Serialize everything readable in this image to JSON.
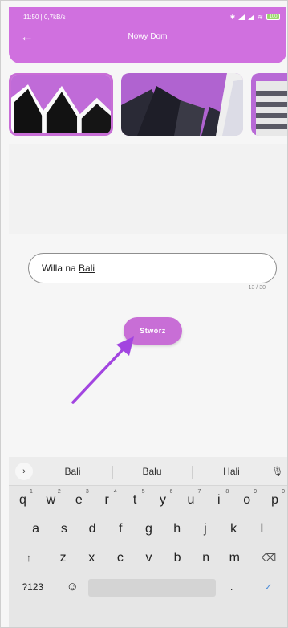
{
  "status_bar": {
    "time": "11:50 | 0,7kB/s",
    "battery": "100"
  },
  "header": {
    "title": "Nowy Dom",
    "back_icon": "arrow-left-icon"
  },
  "colors": {
    "accent": "#c86ed6",
    "header": "#d070df",
    "confirm": "#4a8bd8"
  },
  "name_input": {
    "value_prefix": "Willa na ",
    "value_word": "Bali",
    "counter": "13 / 30"
  },
  "create_button": {
    "label": "Stwórz"
  },
  "keyboard": {
    "suggestions": [
      "Bali",
      "Balu",
      "Hali"
    ],
    "row1": [
      {
        "k": "q",
        "n": "1"
      },
      {
        "k": "w",
        "n": "2"
      },
      {
        "k": "e",
        "n": "3"
      },
      {
        "k": "r",
        "n": "4"
      },
      {
        "k": "t",
        "n": "5"
      },
      {
        "k": "y",
        "n": "6"
      },
      {
        "k": "u",
        "n": "7"
      },
      {
        "k": "i",
        "n": "8"
      },
      {
        "k": "o",
        "n": "9"
      },
      {
        "k": "p",
        "n": "0"
      }
    ],
    "row2": [
      "a",
      "s",
      "d",
      "f",
      "g",
      "h",
      "j",
      "k",
      "l"
    ],
    "row3": [
      "z",
      "x",
      "c",
      "v",
      "b",
      "n",
      "m"
    ],
    "symbols_key": "?123",
    "shift_icon": "↑",
    "backspace_icon": "⌫",
    "emoji_icon": "☺",
    "enter_icon": "✓"
  }
}
